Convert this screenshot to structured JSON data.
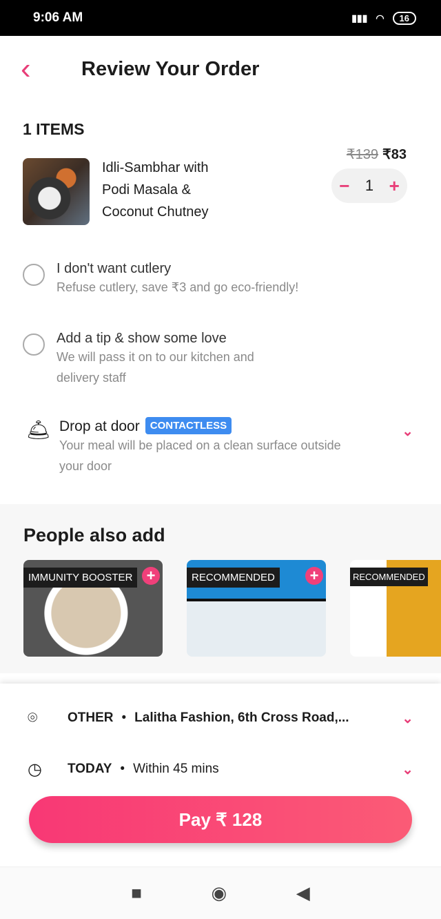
{
  "status": {
    "time": "9:06 AM",
    "battery": "16"
  },
  "header": {
    "title": "Review Your Order"
  },
  "order": {
    "count_label": "1 ITEMS",
    "items": [
      {
        "name": "Idli-Sambhar with Podi Masala & Coconut Chutney",
        "original_price": "₹139",
        "price": "₹83",
        "quantity": "1"
      }
    ]
  },
  "options": {
    "cutlery": {
      "title": "I don't want cutlery",
      "subtitle": "Refuse cutlery, save ₹3 and go eco-friendly!"
    },
    "tip": {
      "title": "Add a tip & show some love",
      "subtitle": "We will pass it on to our kitchen and delivery staff"
    }
  },
  "delivery_mode": {
    "title": "Drop at door",
    "badge": "CONTACTLESS",
    "subtitle": "Your meal will be placed on a clean surface outside your door"
  },
  "people_also_add": {
    "title": "People also add",
    "cards": [
      {
        "tag": "IMMUNITY BOOSTER"
      },
      {
        "tag": "RECOMMENDED"
      },
      {
        "tag": "RECOMMENDED"
      }
    ]
  },
  "address": {
    "label": "OTHER",
    "value": "Lalitha Fashion, 6th Cross Road,..."
  },
  "time": {
    "label": "TODAY",
    "value": "Within 45 mins"
  },
  "pay": {
    "label": "Pay ₹ 128"
  },
  "colors": {
    "accent": "#e83e78",
    "badge": "#3e8cf0"
  }
}
